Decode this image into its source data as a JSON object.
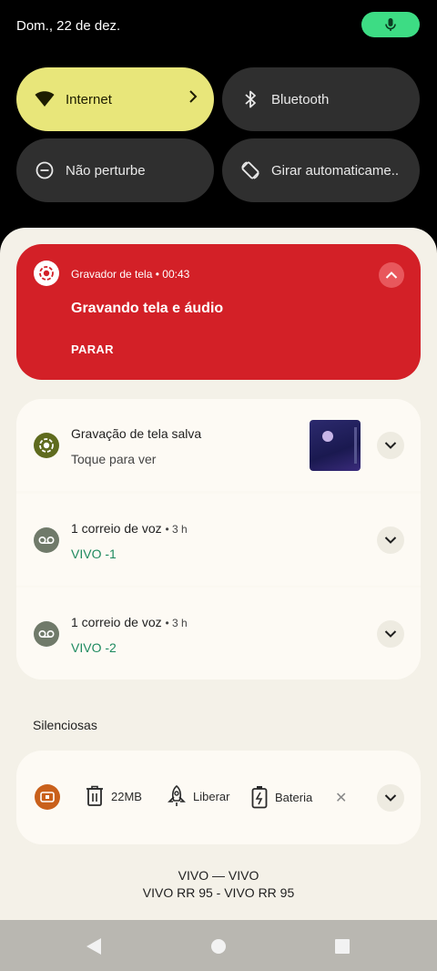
{
  "status": {
    "date": "Dom., 22 de dez."
  },
  "quick_settings": {
    "internet": "Internet",
    "bluetooth": "Bluetooth",
    "dnd": "Não perturbe",
    "rotate": "Girar automaticame.."
  },
  "recorder": {
    "app": "Gravador de tela",
    "time": "00:43",
    "title": "Gravando tela e áudio",
    "action": "PARAR",
    "accent": "#d32027"
  },
  "notifications": [
    {
      "title": "Gravação de tela salva",
      "time": "",
      "subtitle": "Toque para ver"
    },
    {
      "title": "1 correio de voz",
      "time": "3 h",
      "subtitle": "VIVO -1"
    },
    {
      "title": "1 correio de voz",
      "time": "3 h",
      "subtitle": "VIVO -2"
    }
  ],
  "silent": {
    "section_label": "Silenciosas",
    "storage": "22MB",
    "free": "Liberar",
    "battery": "Bateria"
  },
  "carrier": {
    "line1": "VIVO — VIVO",
    "line2": "VIVO RR 95 - VIVO RR 95"
  }
}
